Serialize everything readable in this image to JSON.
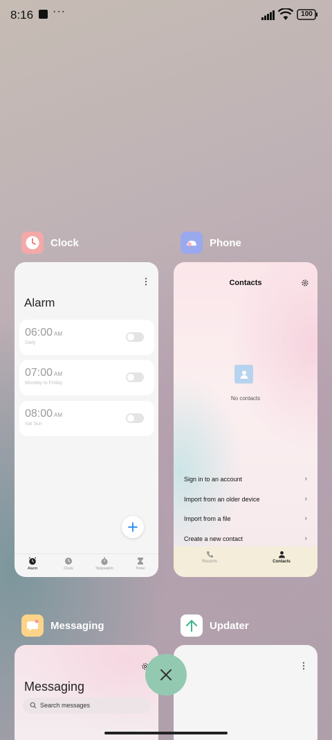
{
  "status_bar": {
    "time": "8:16",
    "dots": "···",
    "battery": "100"
  },
  "apps": {
    "clock": {
      "name": "Clock",
      "screen_title": "Alarm",
      "alarms": [
        {
          "time": "06:00",
          "ampm": "AM",
          "days": "Daily",
          "enabled": false
        },
        {
          "time": "07:00",
          "ampm": "AM",
          "days": "Monday to Friday",
          "enabled": false
        },
        {
          "time": "08:00",
          "ampm": "AM",
          "days": "Sat Sun",
          "enabled": false
        }
      ],
      "tabs": [
        {
          "label": "Alarm",
          "icon": "alarm-clock-icon",
          "active": true
        },
        {
          "label": "Clock",
          "icon": "clock-icon",
          "active": false
        },
        {
          "label": "Stopwatch",
          "icon": "stopwatch-icon",
          "active": false
        },
        {
          "label": "Timer",
          "icon": "hourglass-icon",
          "active": false
        }
      ]
    },
    "phone": {
      "name": "Phone",
      "screen_title": "Contacts",
      "empty_text": "No contacts",
      "options": [
        "Sign in to an account",
        "Import from an older device",
        "Import from a file",
        "Create a new contact"
      ],
      "tabs": [
        {
          "label": "Recents",
          "icon": "phone-icon",
          "active": false
        },
        {
          "label": "Contacts",
          "icon": "person-icon",
          "active": true
        }
      ]
    },
    "messaging": {
      "name": "Messaging",
      "screen_title": "Messaging",
      "search_placeholder": "Search messages"
    },
    "updater": {
      "name": "Updater"
    }
  },
  "colors": {
    "accent": "#1e88e5",
    "close_button": "#93c9b1"
  }
}
